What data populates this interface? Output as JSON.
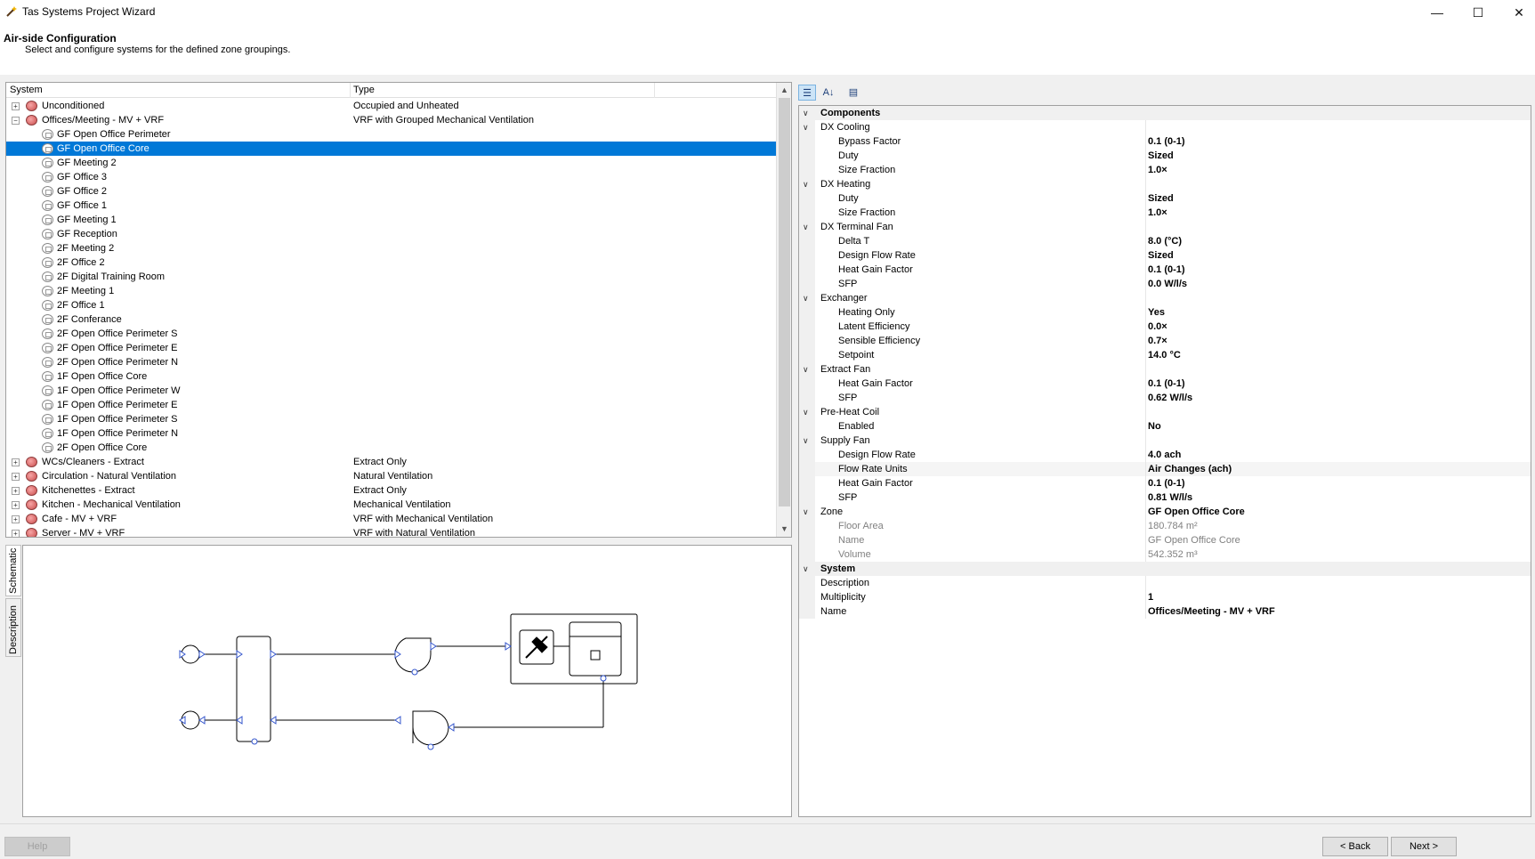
{
  "window": {
    "title": "Tas Systems Project Wizard"
  },
  "header": {
    "title": "Air-side Configuration",
    "subtitle": "Select and configure systems for the defined zone groupings."
  },
  "tree": {
    "columns": [
      "System",
      "Type"
    ],
    "rows": [
      {
        "kind": "system",
        "label": "Unconditioned",
        "type": "Occupied and Unheated",
        "expanded": false
      },
      {
        "kind": "system",
        "label": "Offices/Meeting - MV + VRF",
        "type": "VRF with Grouped Mechanical Ventilation",
        "expanded": true
      },
      {
        "kind": "zone",
        "label": "GF Open Office Perimeter",
        "type": ""
      },
      {
        "kind": "zone",
        "label": "GF Open Office Core",
        "type": "",
        "selected": true
      },
      {
        "kind": "zone",
        "label": "GF Meeting 2",
        "type": ""
      },
      {
        "kind": "zone",
        "label": "GF Office 3",
        "type": ""
      },
      {
        "kind": "zone",
        "label": "GF Office 2",
        "type": ""
      },
      {
        "kind": "zone",
        "label": "GF Office 1",
        "type": ""
      },
      {
        "kind": "zone",
        "label": "GF Meeting 1",
        "type": ""
      },
      {
        "kind": "zone",
        "label": "GF Reception",
        "type": ""
      },
      {
        "kind": "zone",
        "label": "2F Meeting 2",
        "type": ""
      },
      {
        "kind": "zone",
        "label": "2F Office 2",
        "type": ""
      },
      {
        "kind": "zone",
        "label": "2F Digital Training Room",
        "type": ""
      },
      {
        "kind": "zone",
        "label": "2F Meeting 1",
        "type": ""
      },
      {
        "kind": "zone",
        "label": "2F Office 1",
        "type": ""
      },
      {
        "kind": "zone",
        "label": "2F Conferance",
        "type": ""
      },
      {
        "kind": "zone",
        "label": "2F Open Office Perimeter S",
        "type": ""
      },
      {
        "kind": "zone",
        "label": "2F Open Office Perimeter E",
        "type": ""
      },
      {
        "kind": "zone",
        "label": "2F Open Office Perimeter N",
        "type": ""
      },
      {
        "kind": "zone",
        "label": "1F Open Office Core",
        "type": ""
      },
      {
        "kind": "zone",
        "label": "1F Open Office Perimeter W",
        "type": ""
      },
      {
        "kind": "zone",
        "label": "1F Open Office Perimeter E",
        "type": ""
      },
      {
        "kind": "zone",
        "label": "1F Open Office Perimeter S",
        "type": ""
      },
      {
        "kind": "zone",
        "label": "1F Open Office Perimeter N",
        "type": ""
      },
      {
        "kind": "zone",
        "label": "2F Open Office Core",
        "type": ""
      },
      {
        "kind": "system",
        "label": "WCs/Cleaners - Extract",
        "type": "Extract Only",
        "expanded": false
      },
      {
        "kind": "system",
        "label": "Circulation - Natural Ventilation",
        "type": "Natural Ventilation",
        "expanded": false
      },
      {
        "kind": "system",
        "label": "Kitchenettes - Extract",
        "type": "Extract Only",
        "expanded": false
      },
      {
        "kind": "system",
        "label": "Kitchen - Mechanical Ventilation",
        "type": "Mechanical Ventilation",
        "expanded": false
      },
      {
        "kind": "system",
        "label": "Cafe - MV + VRF",
        "type": "VRF with Mechanical Ventilation",
        "expanded": false
      },
      {
        "kind": "system",
        "label": "Server - MV + VRF",
        "type": "VRF with Natural Ventilation",
        "expanded": false
      }
    ]
  },
  "side_tabs": [
    "Schematic",
    "Description"
  ],
  "properties": {
    "rows": [
      {
        "level": "cat",
        "name": "Components",
        "value": ""
      },
      {
        "level": "sub",
        "name": "DX Cooling",
        "value": ""
      },
      {
        "level": "leaf",
        "name": "Bypass Factor",
        "value": "0.1 (0-1)"
      },
      {
        "level": "leaf",
        "name": "Duty",
        "value": "Sized"
      },
      {
        "level": "leaf",
        "name": "Size Fraction",
        "value": "1.0×"
      },
      {
        "level": "sub",
        "name": "DX Heating",
        "value": ""
      },
      {
        "level": "leaf",
        "name": "Duty",
        "value": "Sized"
      },
      {
        "level": "leaf",
        "name": "Size Fraction",
        "value": "1.0×"
      },
      {
        "level": "sub",
        "name": "DX Terminal Fan",
        "value": ""
      },
      {
        "level": "leaf",
        "name": "Delta T",
        "value": "8.0 (°C)"
      },
      {
        "level": "leaf",
        "name": "Design Flow Rate",
        "value": "Sized"
      },
      {
        "level": "leaf",
        "name": "Heat Gain Factor",
        "value": "0.1 (0-1)"
      },
      {
        "level": "leaf",
        "name": "SFP",
        "value": "0.0 W/l/s"
      },
      {
        "level": "sub",
        "name": "Exchanger",
        "value": ""
      },
      {
        "level": "leaf",
        "name": "Heating Only",
        "value": "Yes"
      },
      {
        "level": "leaf",
        "name": "Latent Efficiency",
        "value": "0.0×"
      },
      {
        "level": "leaf",
        "name": "Sensible Efficiency",
        "value": "0.7×"
      },
      {
        "level": "leaf",
        "name": "Setpoint",
        "value": "14.0 °C"
      },
      {
        "level": "sub",
        "name": "Extract Fan",
        "value": ""
      },
      {
        "level": "leaf",
        "name": "Heat Gain Factor",
        "value": "0.1 (0-1)"
      },
      {
        "level": "leaf",
        "name": "SFP",
        "value": "0.62 W/l/s"
      },
      {
        "level": "sub",
        "name": "Pre-Heat Coil",
        "value": ""
      },
      {
        "level": "leaf",
        "name": "Enabled",
        "value": "No"
      },
      {
        "level": "sub",
        "name": "Supply Fan",
        "value": ""
      },
      {
        "level": "leaf",
        "name": "Design Flow Rate",
        "value": "4.0 ach"
      },
      {
        "level": "leaf",
        "name": "Flow Rate Units",
        "value": "Air Changes (ach)",
        "highlight": true
      },
      {
        "level": "leaf",
        "name": "Heat Gain Factor",
        "value": "0.1 (0-1)"
      },
      {
        "level": "leaf",
        "name": "SFP",
        "value": "0.81 W/l/s"
      },
      {
        "level": "sub",
        "name": "Zone",
        "value": "GF Open Office Core"
      },
      {
        "level": "leaf",
        "name": "Floor Area",
        "value": "180.784 m²",
        "readonly": true
      },
      {
        "level": "leaf",
        "name": "Name",
        "value": "GF Open Office Core",
        "readonly": true
      },
      {
        "level": "leaf",
        "name": "Volume",
        "value": "542.352 m³",
        "readonly": true
      },
      {
        "level": "cat",
        "name": "System",
        "value": ""
      },
      {
        "level": "sub",
        "name": "Description",
        "value": "",
        "nochev": true
      },
      {
        "level": "sub",
        "name": "Multiplicity",
        "value": "1",
        "nochev": true
      },
      {
        "level": "sub",
        "name": "Name",
        "value": "Offices/Meeting - MV + VRF",
        "nochev": true
      }
    ]
  },
  "footer": {
    "help": "Help",
    "back": "< Back",
    "next": "Next >"
  }
}
